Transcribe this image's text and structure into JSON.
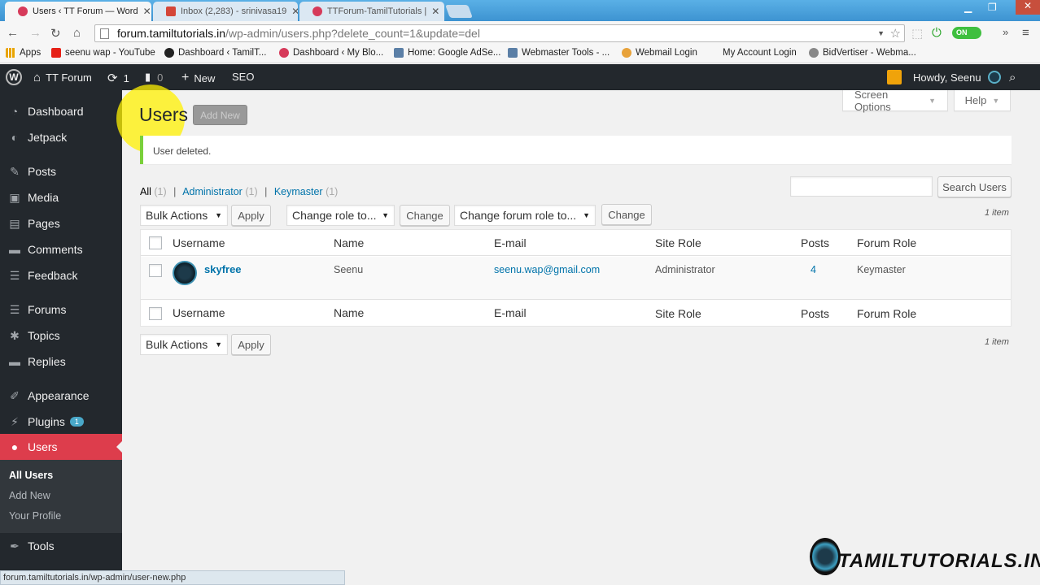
{
  "browser": {
    "tabs": [
      {
        "label": "Users ‹ TT Forum — Word",
        "active": true,
        "favicon_color": "#d63a5a"
      },
      {
        "label": "Inbox (2,283) - srinivasa19",
        "active": false,
        "favicon_color": "#d44638"
      },
      {
        "label": "TTForum-TamilTutorials |",
        "active": false,
        "favicon_color": "#d63a5a"
      }
    ],
    "url_host": "forum.tamiltutorials.in",
    "url_path": "/wp-admin/users.php?delete_count=1&update=del",
    "ext_toggle": "ON",
    "bookmarks": [
      {
        "label": "Apps",
        "color": "#e9a400"
      },
      {
        "label": "seenu wap - YouTube",
        "color": "#e62117"
      },
      {
        "label": "Dashboard ‹ TamilT...",
        "color": "#222222"
      },
      {
        "label": "Dashboard ‹ My Blo...",
        "color": "#d63a5a"
      },
      {
        "label": "Home: Google AdSe...",
        "color": "#5b7fa6"
      },
      {
        "label": "Webmaster Tools - ...",
        "color": "#5b7fa6"
      },
      {
        "label": "Webmail Login",
        "color": "#e8a23a"
      },
      {
        "label": "My Account Login",
        "color": "#f6f6f6"
      },
      {
        "label": "BidVertiser - Webma...",
        "color": "#888888"
      }
    ],
    "status_url": "forum.tamiltutorials.in/wp-admin/user-new.php"
  },
  "adminbar": {
    "site_name": "TT Forum",
    "updates_count": "1",
    "comments_count": "0",
    "new_label": "New",
    "seo_label": "SEO",
    "howdy": "Howdy, Seenu"
  },
  "sidebar": {
    "items": [
      {
        "label": "Dashboard",
        "icon": "dashboard-icon",
        "glyph": "◔"
      },
      {
        "label": "Jetpack",
        "icon": "jetpack-icon",
        "glyph": "◐"
      },
      {
        "label": "Posts",
        "icon": "pushpin-icon",
        "glyph": "✎"
      },
      {
        "label": "Media",
        "icon": "media-icon",
        "glyph": "▣"
      },
      {
        "label": "Pages",
        "icon": "pages-icon",
        "glyph": "▤"
      },
      {
        "label": "Comments",
        "icon": "comments-icon",
        "glyph": "▬"
      },
      {
        "label": "Feedback",
        "icon": "feedback-icon",
        "glyph": "☰"
      },
      {
        "label": "Forums",
        "icon": "forums-icon",
        "glyph": "☰"
      },
      {
        "label": "Topics",
        "icon": "topics-icon",
        "glyph": "✱"
      },
      {
        "label": "Replies",
        "icon": "replies-icon",
        "glyph": "▬"
      },
      {
        "label": "Appearance",
        "icon": "appearance-icon",
        "glyph": "✐"
      },
      {
        "label": "Plugins",
        "icon": "plugins-icon",
        "glyph": "⚡",
        "badge": "1"
      },
      {
        "label": "Users",
        "icon": "users-icon",
        "glyph": "●",
        "current": true
      },
      {
        "label": "Tools",
        "icon": "tools-icon",
        "glyph": "✒"
      }
    ],
    "users_submenu": [
      "All Users",
      "Add New",
      "Your Profile"
    ]
  },
  "main": {
    "page_title": "Users",
    "add_new_label": "Add New",
    "screen_options_label": "Screen Options",
    "help_label": "Help",
    "notice": "User deleted.",
    "views": [
      {
        "label": "All",
        "count": "(1)",
        "current": true
      },
      {
        "label": "Administrator",
        "count": "(1)"
      },
      {
        "label": "Keymaster",
        "count": "(1)"
      }
    ],
    "search_button": "Search Users",
    "search_value": "",
    "bulk_actions": "Bulk Actions",
    "apply_label": "Apply",
    "change_role": "Change role to...",
    "change_label": "Change",
    "change_forum_role": "Change forum role to...",
    "item_count": "1 item",
    "columns": [
      "Username",
      "Name",
      "E-mail",
      "Site Role",
      "Posts",
      "Forum Role"
    ],
    "rows": [
      {
        "username": "skyfree",
        "name": "Seenu",
        "email": "seenu.wap@gmail.com",
        "site_role": "Administrator",
        "posts": "4",
        "forum_role": "Keymaster"
      }
    ]
  },
  "watermark": "TAMILTUTORIALS.IN",
  "colors": {
    "accent": "#0073aa",
    "current_menu": "#dd3d4c",
    "notice": "#7ad03a",
    "adminbar": "#23282d"
  }
}
